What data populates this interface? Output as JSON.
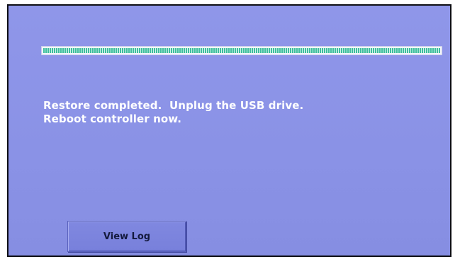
{
  "status": {
    "progress_fraction": 1.0,
    "message_line1": "Restore completed.  Unplug the USB drive.",
    "message_line2": "Reboot controller now."
  },
  "actions": {
    "view_log_label": "View Log"
  },
  "colors": {
    "screen_background": "#8f96e9",
    "progress_fill": "#3ebf9d",
    "text": "#ffffff"
  }
}
